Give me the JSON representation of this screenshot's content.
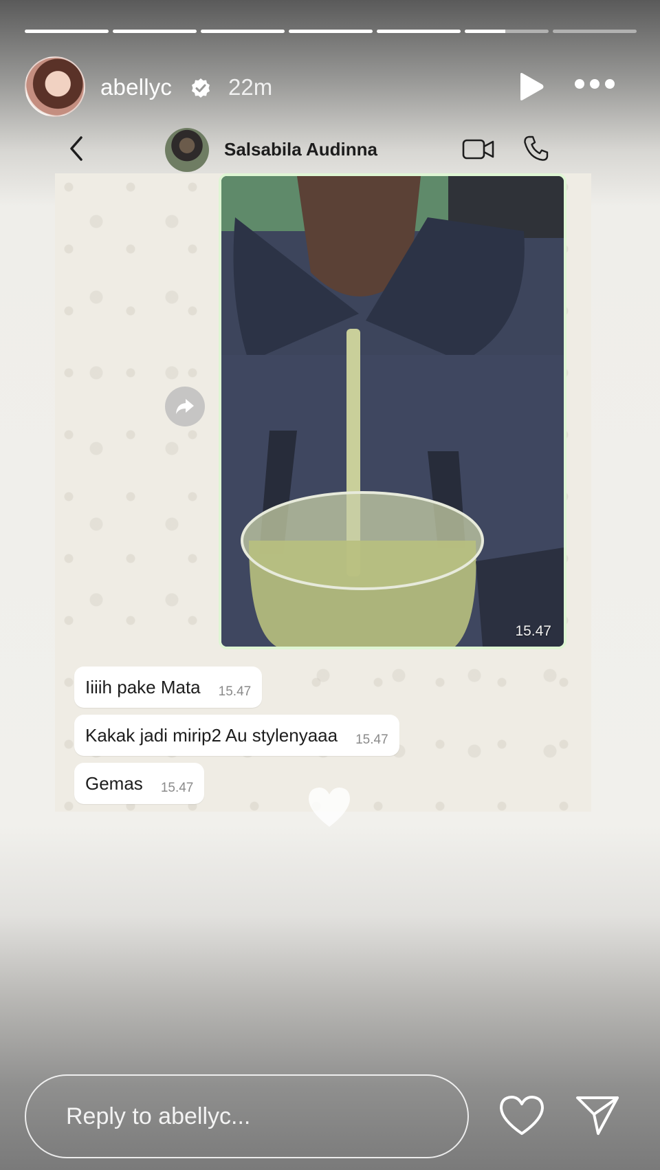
{
  "story": {
    "progress": [
      1,
      1,
      1,
      1,
      1,
      0.48,
      0
    ],
    "username": "abellyc",
    "time_ago": "22m",
    "verified": true
  },
  "chat": {
    "contact_name": "Salsabila Audinna",
    "photo_time": "15.47",
    "messages": [
      {
        "text": "Iiiih pake Mata",
        "time": "15.47"
      },
      {
        "text": "Kakak jadi mirip2 Au stylenyaaa",
        "time": "15.47"
      },
      {
        "text": "Gemas",
        "time": "15.47"
      }
    ]
  },
  "reply": {
    "placeholder": "Reply to abellyc..."
  },
  "icons": {
    "verified": "verified-badge-icon",
    "play": "play-icon",
    "more": "more-options-icon",
    "back": "chevron-left-icon",
    "video": "video-call-icon",
    "call": "phone-icon",
    "forward": "forward-icon",
    "heart": "heart-icon",
    "share": "send-icon"
  },
  "colors": {
    "bubble_outgoing_border": "#dff6d4",
    "chat_bg": "#efece4",
    "bubble_incoming": "#ffffff"
  }
}
